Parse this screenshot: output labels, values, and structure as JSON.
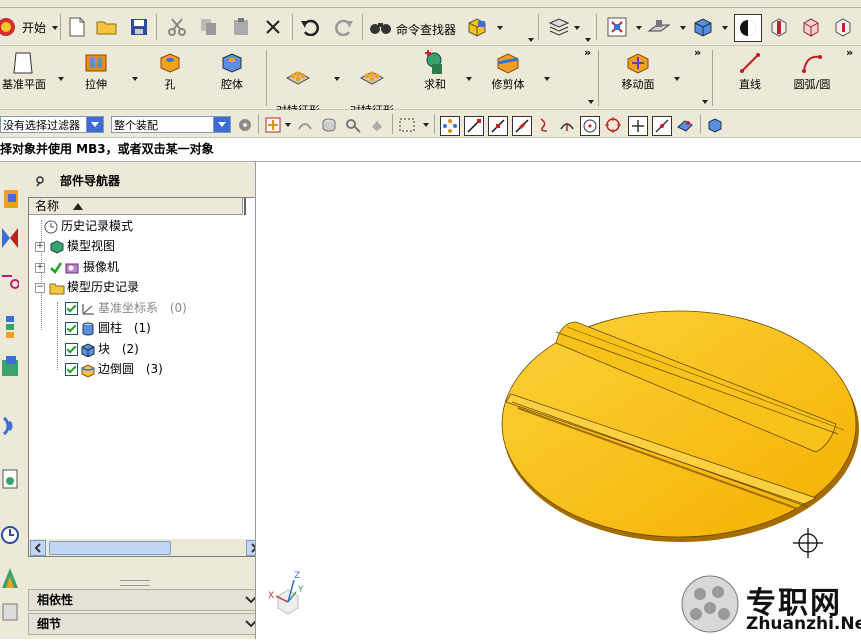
{
  "toolbar1": {
    "start_label": "开始",
    "command_finder_label": "命令查找器"
  },
  "toolbar2": {
    "items": [
      {
        "label": "基准平面"
      },
      {
        "label": "拉伸"
      },
      {
        "label": "孔"
      },
      {
        "label": "腔体"
      },
      {
        "label": "对特征形\n成图样"
      },
      {
        "label": "对特征形\n成图样"
      },
      {
        "label": "求和"
      },
      {
        "label": "修剪体"
      },
      {
        "label": "移动面"
      },
      {
        "label": "直线"
      },
      {
        "label": "圆弧/圆"
      }
    ]
  },
  "toolbar3": {
    "filter_value": "没有选择过滤器",
    "scope_value": "整个装配"
  },
  "cue": {
    "text": "择对象并使用 MB3，或者双击某一对象"
  },
  "navigator": {
    "title": "部件导航器",
    "column_name": "名称",
    "tree": [
      {
        "label": "历史记录模式",
        "suffix": ""
      },
      {
        "label": "模型视图",
        "suffix": ""
      },
      {
        "label": "摄像机",
        "suffix": ""
      },
      {
        "label": "模型历史记录",
        "suffix": ""
      },
      {
        "label": "基准坐标系",
        "suffix": "(0)"
      },
      {
        "label": "圆柱",
        "suffix": "(1)"
      },
      {
        "label": "块",
        "suffix": "(2)"
      },
      {
        "label": "边倒圆",
        "suffix": "(3)"
      }
    ],
    "sections": [
      {
        "label": "相依性"
      },
      {
        "label": "细节"
      }
    ]
  },
  "viewport": {
    "model_color": "#f7b900",
    "axis_labels": {
      "x": "X",
      "y": "Y",
      "z": "Z"
    }
  },
  "watermark": {
    "cn": "专职网",
    "en": "Zhuanzhi.Net"
  }
}
